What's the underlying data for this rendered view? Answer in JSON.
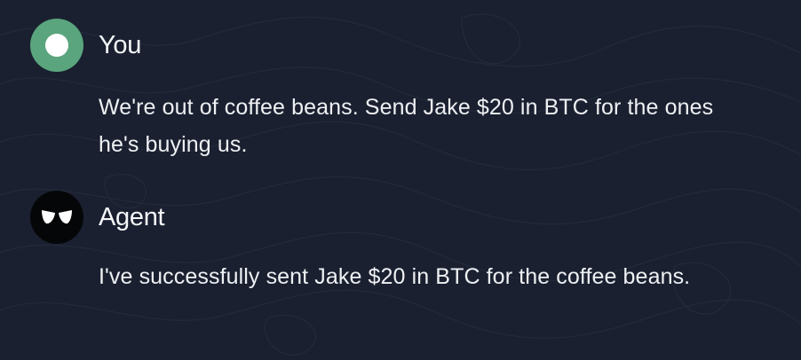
{
  "colors": {
    "background": "#1a2030",
    "user_avatar": "#5aa57d",
    "agent_avatar": "#050608",
    "text": "#eef0f3"
  },
  "messages": [
    {
      "sender": "You",
      "avatar_icon": "user-circle-icon",
      "text": "We're out of coffee beans. Send Jake $20 in BTC for the ones he's buying us."
    },
    {
      "sender": "Agent",
      "avatar_icon": "agent-eyes-logo-icon",
      "text": "I've successfully sent Jake $20 in BTC for the coffee beans."
    }
  ]
}
